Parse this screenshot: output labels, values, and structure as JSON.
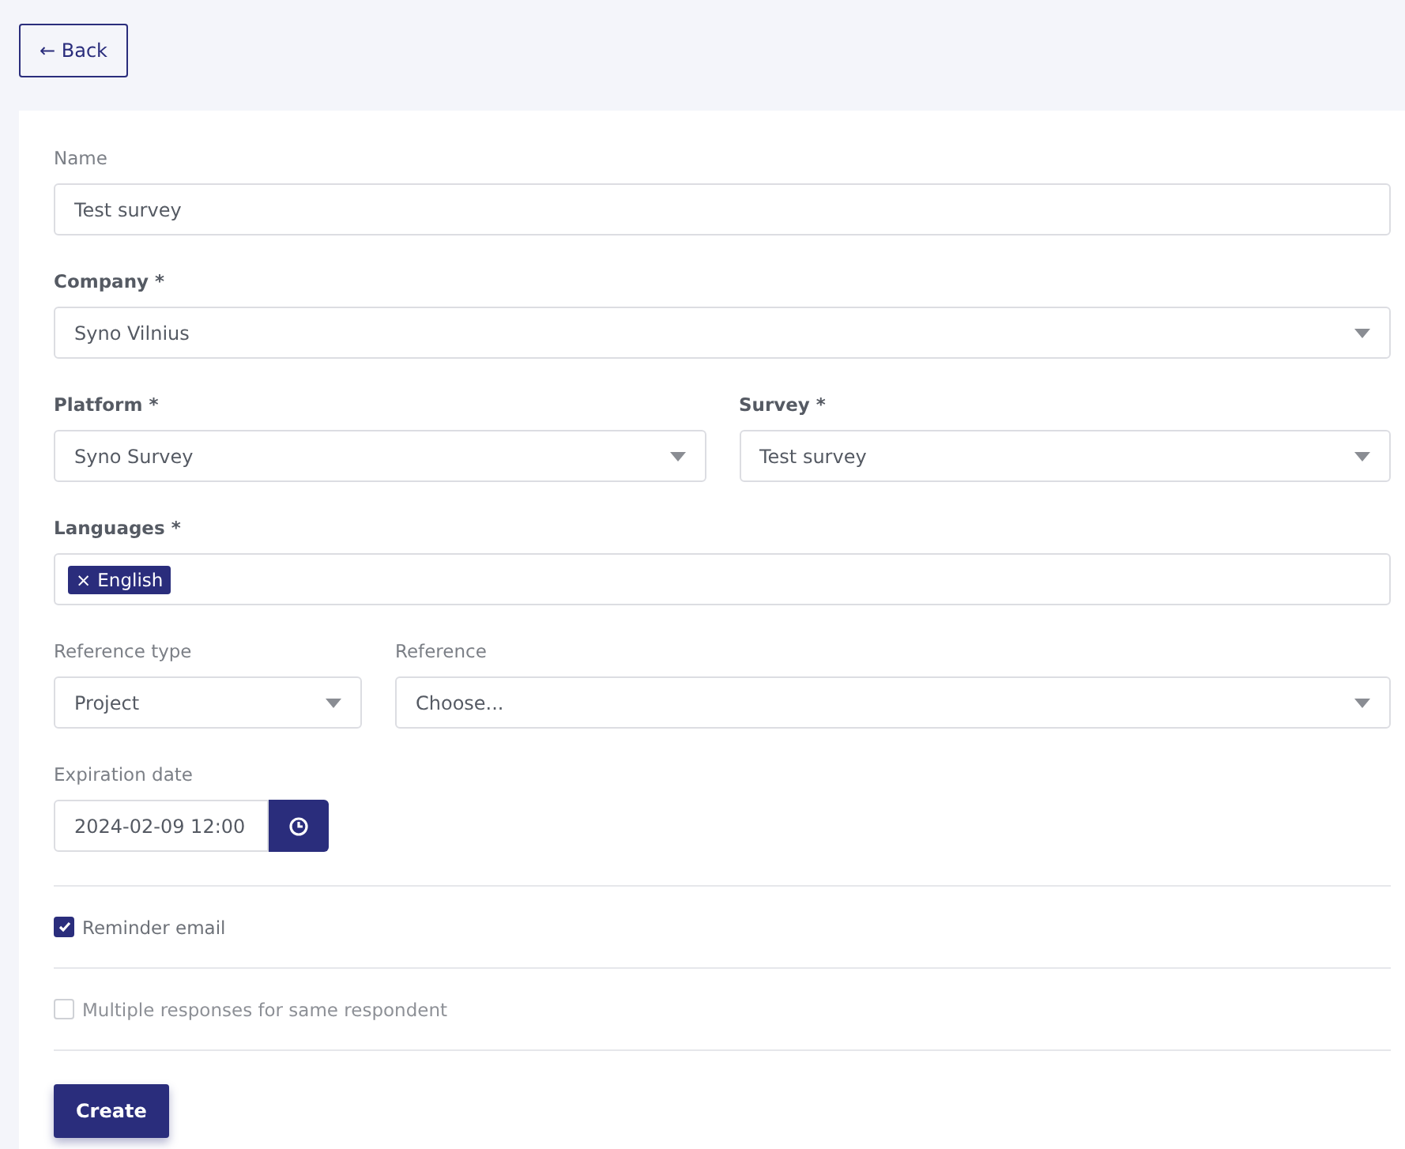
{
  "back_button": {
    "label": "← Back"
  },
  "form": {
    "rows": [
      {
        "fields": [
          {
            "kind": "text",
            "label": "Name",
            "required": false,
            "value": "Test survey"
          }
        ]
      },
      {
        "fields": [
          {
            "kind": "select",
            "label": "Company *",
            "required": true,
            "value": "Syno Vilnius"
          }
        ]
      },
      {
        "fields": [
          {
            "kind": "select",
            "label": "Platform *",
            "required": true,
            "value": "Syno Survey"
          },
          {
            "kind": "select",
            "label": "Survey *",
            "required": true,
            "value": "Test survey"
          }
        ]
      },
      {
        "fields": [
          {
            "kind": "tags",
            "label": "Languages *",
            "required": true,
            "tags": [
              {
                "remove": "×",
                "label": "English"
              }
            ]
          }
        ]
      },
      {
        "fields": [
          {
            "kind": "select",
            "label": "Reference type",
            "required": false,
            "value": "Project",
            "narrow": true
          },
          {
            "kind": "select",
            "label": "Reference",
            "required": false,
            "placeholder": "Choose..."
          }
        ]
      },
      {
        "fields": [
          {
            "kind": "date",
            "label": "Expiration date",
            "required": false,
            "value": "2024-02-09 12:00"
          }
        ]
      }
    ],
    "checkboxes": [
      {
        "label": "Reminder email",
        "checked": true
      },
      {
        "label": "Multiple responses for same respondent",
        "checked": false
      }
    ],
    "submit": {
      "label": "Create"
    }
  }
}
